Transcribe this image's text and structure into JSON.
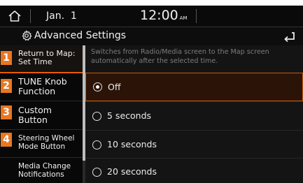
{
  "status_bar": {
    "date": "Jan.  1",
    "time": "12:00",
    "ampm": "AM"
  },
  "header": {
    "title": "Advanced Settings"
  },
  "icons": {
    "home": "home-icon",
    "settings": "gear-icon",
    "back": "back-return-icon"
  },
  "menu": {
    "items": [
      {
        "badge": "1",
        "label": "Return to Map:\nSet Time",
        "selected": true
      },
      {
        "badge": "2",
        "label": "TUNE Knob\nFunction"
      },
      {
        "badge": "3",
        "label": "Custom\nButton"
      },
      {
        "badge": "4",
        "label": "Steering Wheel\nMode Button"
      },
      {
        "badge": "",
        "label": "Media Change\nNotifications"
      }
    ]
  },
  "panel": {
    "description": "Switches from Radio/Media screen to the Map screen automatically after the selected time.",
    "options": [
      {
        "label": "Off",
        "selected": true
      },
      {
        "label": "5 seconds"
      },
      {
        "label": "10 seconds"
      },
      {
        "label": "20 seconds"
      }
    ]
  },
  "colors": {
    "accent": "#e87722",
    "selected_border": "#e85c00",
    "background": "#0a0a0a"
  }
}
